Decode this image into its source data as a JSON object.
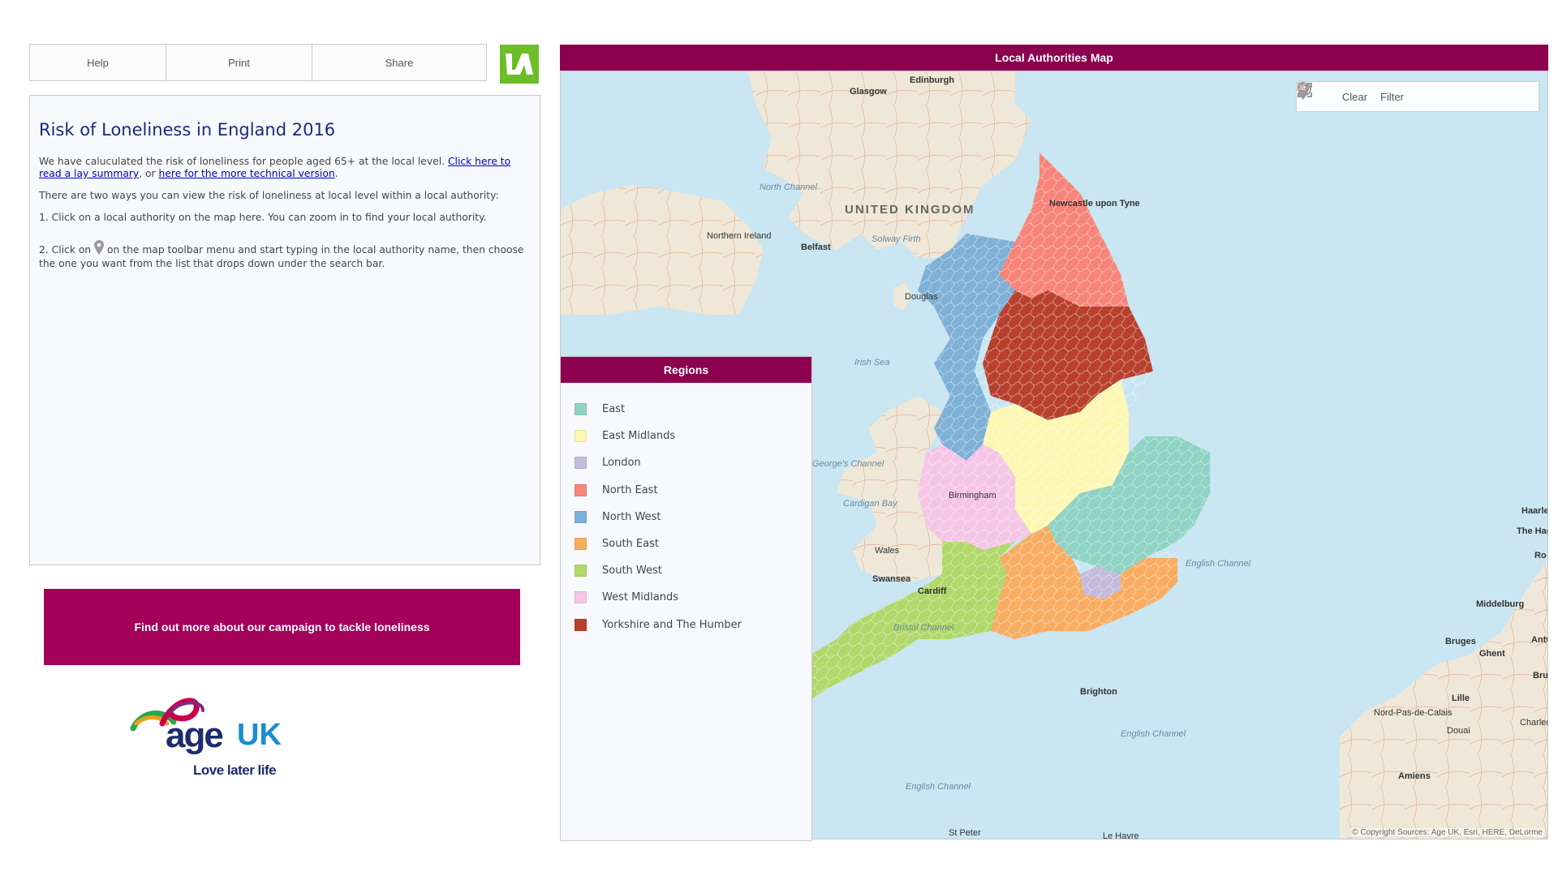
{
  "toolbar": {
    "help": "Help",
    "print": "Print",
    "share": "Share"
  },
  "info": {
    "title": "Risk of Loneliness in England 2016",
    "p1_text": "We have caluculated the risk of loneliness for people aged 65+ at the local level.",
    "p1_link1": "Click here to read a lay summary",
    "p1_mid": ", or",
    "p1_link2": "here for the more technical version",
    "p1_end": ".",
    "p2": "There are two ways you can view the risk of loneliness at local level within a local authority:",
    "p3": "1. Click on a local authority on the map here. You can zoom in to find your local authority.",
    "p4_pre": "2. Click on",
    "p4_post": "on the map toolbar menu and start typing in the local authority name, then choose the one you want from the list that drops down under the search bar."
  },
  "campaign": {
    "label": "Find out more about our campaign to tackle loneliness"
  },
  "logo": {
    "age": "age",
    "uk": "UK",
    "tagline": "Love later life"
  },
  "map": {
    "title": "Local Authorities Map",
    "tools": {
      "clear": "Clear",
      "filter": "Filter"
    },
    "copyright": "© Copyright Sources: Age UK, Esri, HERE, DeLorme",
    "labels": {
      "edinburgh": "Edinburgh",
      "glasgow": "Glasgow",
      "united_kingdom": "UNITED KINGDOM",
      "belfast": "Belfast",
      "northern_ireland": "Northern Ireland",
      "north_channel": "North Channel",
      "solway_firth": "Solway Firth",
      "douglas": "Douglas",
      "irish_sea": "Irish Sea",
      "newcastle": "Newcastle upon Tyne",
      "georges_channel": "George's Channel",
      "cardigan_bay": "Cardigan Bay",
      "wales": "Wales",
      "swansea": "Swansea",
      "cardiff": "Cardiff",
      "bristol_channel": "Bristol Channel",
      "birmingham": "Birmingham",
      "brighton": "Brighton",
      "english_channel": "English Channel",
      "english_channel_2": "English Channel",
      "english_channel_3": "English Channel",
      "st_peter": "St Peter",
      "le_havre": "Le Havre",
      "haarlem": "Haarle",
      "the_hague": "The Hague",
      "middelburg": "Middelburg",
      "bruges": "Bruges",
      "ghent": "Ghent",
      "lille": "Lille",
      "amiens": "Amiens",
      "douai": "Douai",
      "nord_pas_de_calais": "Nord-Pas-de-Calais",
      "ro": "Ro",
      "antw": "Antw",
      "brus": "Brus",
      "charleroi": "Charlero"
    }
  },
  "legend": {
    "title": "Regions",
    "items": [
      {
        "label": "East",
        "color": "#8fd4c4"
      },
      {
        "label": "East Midlands",
        "color": "#fdf7b4"
      },
      {
        "label": "London",
        "color": "#c3bcdc"
      },
      {
        "label": "North East",
        "color": "#f7857a"
      },
      {
        "label": "North West",
        "color": "#7fb0d6"
      },
      {
        "label": "South East",
        "color": "#f8ad62"
      },
      {
        "label": "South West",
        "color": "#b0d86a"
      },
      {
        "label": "West Midlands",
        "color": "#f6c6e6"
      },
      {
        "label": "Yorkshire and The Humber",
        "color": "#b8412e"
      }
    ]
  },
  "colors": {
    "header": "#8b004f",
    "campaign": "#a3005a",
    "ia_logo": "#6cbd26",
    "sea": "#c9e6f2",
    "land": "#efe8d8"
  }
}
